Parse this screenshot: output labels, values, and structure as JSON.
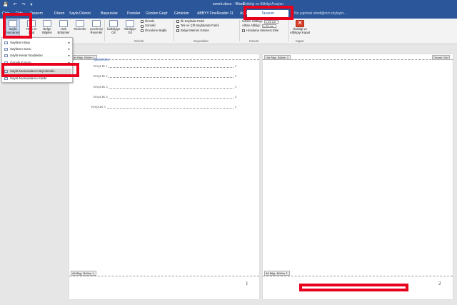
{
  "titlebar": {
    "doc_title": "ornek.docx - Word",
    "context_title": "Üstbilgi ve Altbilgi Araçları",
    "qat": [
      "💾",
      "↶",
      "↷",
      "▾"
    ]
  },
  "tabs": [
    "Giriş",
    "Ekle",
    "Tasarım",
    "Düzen",
    "Sayfa Düzeni",
    "Başvurular",
    "Postalar",
    "Gözden Geçir",
    "Görünüm",
    "ABBYY FineReader 11",
    "ACROBAT"
  ],
  "context_tab": "Tasarım",
  "tellme_placeholder": "Ne yapmak istediğinizi söyleyin...",
  "ribbon": {
    "page_number_btn": "Sayfa Numarası",
    "date_time_btn": "Tarih ve Saat",
    "doc_info_btn": "Belge Bilgileri",
    "quick_parts_btn": "Hızlı Bölümler",
    "pictures_btn": "Resimler",
    "online_pictures_btn": "Çevrimiçi Resimler",
    "goto_header_btn": "Üstbilgiye Git",
    "goto_footer_btn": "Altbilgiye Git",
    "previous": "Önceki",
    "next": "Sonraki",
    "link_previous": "Öncekine Bağla",
    "nav_group": "Gezinti",
    "opt_diff_first": "İlk Sayfada Farklı",
    "opt_odd_even": "Tek ve Çift Sayfalarda Farklı",
    "opt_show_text": "Belge Metnini Göster",
    "options_group": "Seçenekler",
    "header_from_top": "Üstten Üstbilgi:",
    "footer_from_bottom": "Alttan Altbilgi:",
    "header_val": "1,25 cm",
    "footer_val": "1,25 cm",
    "insert_align_tab": "Hizalama Sekmesi Ekle",
    "position_group": "Konum",
    "close_btn": "Üstbilgi ve Altbilgiyi Kapat",
    "close_group": "Kapat"
  },
  "dropdown": {
    "items": [
      {
        "label": "Sayfanın Başı",
        "submenu": true
      },
      {
        "label": "Sayfanın Sonu",
        "submenu": true
      },
      {
        "label": "Sayfa Kenar Boşlukları",
        "submenu": true
      },
      {
        "label": "Geçerli Konum",
        "submenu": true
      },
      {
        "label": "Sayfa Numaralarını Biçimlendir...",
        "submenu": false
      },
      {
        "label": "Sayfa Numaralarını Kaldır",
        "submenu": false
      }
    ]
  },
  "page1": {
    "header_tag": "Üst Bilgi -Bölüm 1-",
    "footer_tag": "Alt Bilgi -Bölüm 1-",
    "toc_title": "İçindekiler",
    "toc": [
      {
        "label": "BAŞLIK 1",
        "page": "2"
      },
      {
        "label": "BAŞLIK 2",
        "page": "2"
      },
      {
        "label": "BAŞLIK 3",
        "page": "3"
      },
      {
        "label": "BAŞLIK 4",
        "page": "4"
      },
      {
        "label": "BAŞLIK 5",
        "page": "5"
      }
    ],
    "page_number": "1"
  },
  "page2": {
    "header_tag": "Üst Bilgi -Bölüm 2-",
    "same_as_previous": "Önceki Gibi",
    "footer_tag": "Alt Bilgi -Bölüm 2-",
    "page_number": "2"
  }
}
